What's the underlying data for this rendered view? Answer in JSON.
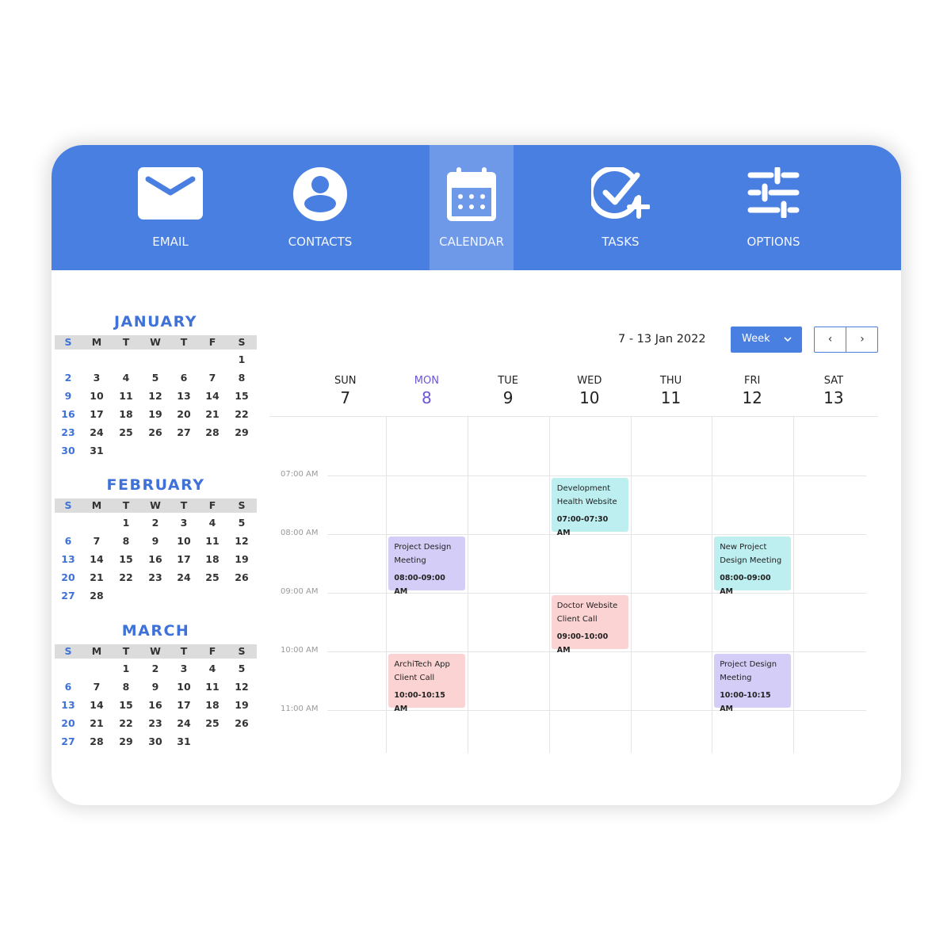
{
  "nav": {
    "items": [
      {
        "label": "EMAIL",
        "icon": "email-icon"
      },
      {
        "label": "CONTACTS",
        "icon": "user-icon"
      },
      {
        "label": "CALENDAR",
        "icon": "calendar-icon",
        "active": true
      },
      {
        "label": "TASKS",
        "icon": "check-plus-icon"
      },
      {
        "label": "OPTIONS",
        "icon": "sliders-icon"
      }
    ],
    "color": "#4a7fe2"
  },
  "mini_calendars": [
    {
      "month": "JANUARY",
      "dow": [
        "S",
        "M",
        "T",
        "W",
        "T",
        "F",
        "S"
      ],
      "start": 6,
      "days": 31
    },
    {
      "month": "FEBRUARY",
      "dow": [
        "S",
        "M",
        "T",
        "W",
        "T",
        "F",
        "S"
      ],
      "start": 2,
      "days": 28
    },
    {
      "month": "MARCH",
      "dow": [
        "S",
        "M",
        "T",
        "W",
        "T",
        "F",
        "S"
      ],
      "start": 2,
      "days": 31
    }
  ],
  "week": {
    "range": "7 - 13 Jan 2022",
    "view": "Week",
    "prev": "‹",
    "next": "›",
    "days": [
      {
        "name": "SUN",
        "date": "7"
      },
      {
        "name": "MON",
        "date": "8",
        "today": true
      },
      {
        "name": "TUE",
        "date": "9"
      },
      {
        "name": "WED",
        "date": "10"
      },
      {
        "name": "THU",
        "date": "11"
      },
      {
        "name": "FRI",
        "date": "12"
      },
      {
        "name": "SAT",
        "date": "13"
      }
    ],
    "times": [
      "07:00 AM",
      "08:00 AM",
      "09:00 AM",
      "10:00 AM",
      "11:00 AM"
    ],
    "events": [
      {
        "day": 3,
        "start": 7,
        "title1": "Development",
        "title2": "Health Website",
        "time": "07:00-07:30 AM",
        "color": "#bdeef0"
      },
      {
        "day": 1,
        "start": 8,
        "title1": "Project Design",
        "title2": "Meeting",
        "time": "08:00-09:00 AM",
        "color": "#d3cdf7"
      },
      {
        "day": 5,
        "start": 8,
        "title1": "New Project",
        "title2": "Design Meeting",
        "time": "08:00-09:00 AM",
        "color": "#bdeef0"
      },
      {
        "day": 3,
        "start": 9,
        "title1": "Doctor Website",
        "title2": "Client Call",
        "time": "09:00-10:00 AM",
        "color": "#fcd3d3"
      },
      {
        "day": 1,
        "start": 10,
        "title1": "ArchiTech App",
        "title2": "Client Call",
        "time": "10:00-10:15 AM",
        "color": "#fcd3d3"
      },
      {
        "day": 5,
        "start": 10,
        "title1": "Project Design",
        "title2": "Meeting",
        "time": "10:00-10:15 AM",
        "color": "#d3cdf7"
      }
    ]
  }
}
